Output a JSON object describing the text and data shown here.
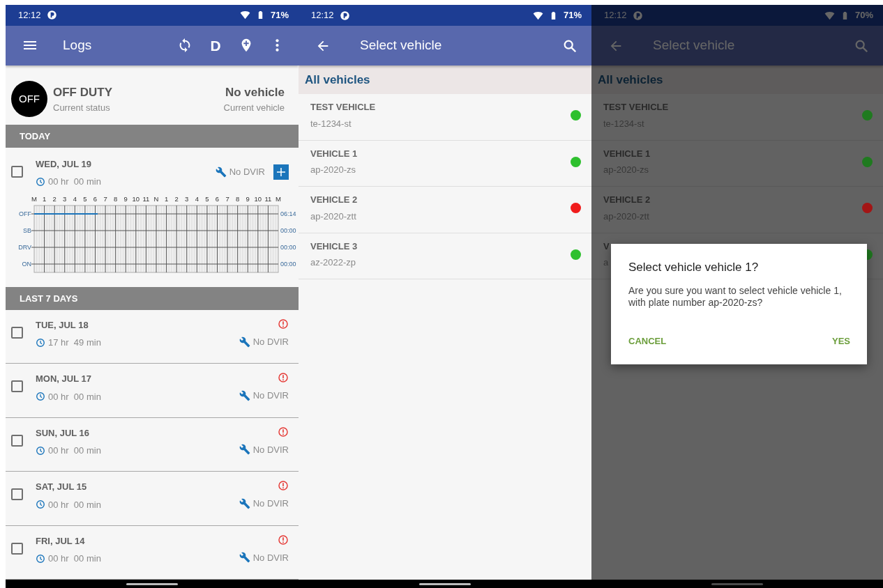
{
  "logs_screen": {
    "status_bar": {
      "time": "12:12",
      "battery": "71%"
    },
    "app_bar": {
      "title": "Logs",
      "driver_letter": "D"
    },
    "duty": {
      "badge": "OFF",
      "title": "OFF DUTY",
      "subtitle": "Current status"
    },
    "vehicle": {
      "title": "No vehicle",
      "subtitle": "Current vehicle"
    },
    "sections": [
      {
        "header": "TODAY",
        "days": [
          {
            "kind": "today",
            "date": "WED, JUL 19",
            "duration": "00 hr  00 min",
            "dvir": "No DVIR",
            "checked": false,
            "violation": false,
            "log_graph": {
              "hour_labels": [
                "M",
                "1",
                "2",
                "3",
                "4",
                "5",
                "6",
                "7",
                "8",
                "9",
                "10",
                "11",
                "N",
                "1",
                "2",
                "3",
                "4",
                "5",
                "6",
                "7",
                "8",
                "9",
                "10",
                "11",
                "M"
              ],
              "rows": [
                {
                  "label": "OFF",
                  "total": "06:14",
                  "level": 0.26
                },
                {
                  "label": "SB",
                  "total": "00:00"
                },
                {
                  "label": "DRV",
                  "total": "00:00"
                },
                {
                  "label": "ON",
                  "total": "00:00"
                }
              ]
            }
          }
        ]
      },
      {
        "header": "LAST 7 DAYS",
        "days": [
          {
            "kind": "past",
            "date": "TUE, JUL 18",
            "duration": "17 hr  49 min",
            "dvir": "No DVIR",
            "checked": false,
            "violation": true
          },
          {
            "kind": "past",
            "date": "MON, JUL 17",
            "duration": "00 hr  00 min",
            "dvir": "No DVIR",
            "checked": false,
            "violation": true
          },
          {
            "kind": "past",
            "date": "SUN, JUL 16",
            "duration": "00 hr  00 min",
            "dvir": "No DVIR",
            "checked": false,
            "violation": true
          },
          {
            "kind": "past",
            "date": "SAT, JUL 15",
            "duration": "00 hr  00 min",
            "dvir": "No DVIR",
            "checked": false,
            "violation": true
          },
          {
            "kind": "past",
            "date": "FRI, JUL 14",
            "duration": "00 hr  00 min",
            "dvir": "No DVIR",
            "checked": false,
            "violation": true
          }
        ]
      }
    ]
  },
  "vehicle_screen": {
    "status_bar": {
      "time": "12:12",
      "battery": "71%"
    },
    "app_bar": {
      "title": "Select vehicle"
    },
    "list_header": "All vehicles",
    "vehicles": [
      {
        "name": "TEST VEHICLE",
        "plate": "te-1234-st",
        "color": "#2ec02e"
      },
      {
        "name": "VEHICLE 1",
        "plate": "ap-2020-zs",
        "color": "#2ec02e"
      },
      {
        "name": "VEHICLE 2",
        "plate": "ap-2020-ztt",
        "color": "#f01c1c"
      },
      {
        "name": "VEHICLE 3",
        "plate": "az-2022-zp",
        "color": "#2ec02e"
      }
    ]
  },
  "confirm_screen": {
    "status_bar": {
      "time": "12:12",
      "battery": "70%"
    },
    "app_bar": {
      "title": "Select vehicle"
    },
    "list_header": "All vehicles",
    "vehicles": [
      {
        "name": "TEST VEHICLE",
        "plate": "te-1234-st",
        "color": "#1f7a1f"
      },
      {
        "name": "VEHICLE 1",
        "plate": "ap-2020-zs",
        "color": "#1f7a1f"
      },
      {
        "name": "VEHICLE 2",
        "plate": "ap-2020-ztt",
        "color": "#a31515"
      },
      {
        "name": "V",
        "plate": "a",
        "color": "#1f7a1f"
      }
    ],
    "dialog": {
      "title": "Select vehicle vehicle 1?",
      "message": "Are you sure you want to select vehicle vehicle 1, with plate number ap-2020-zs?",
      "buttons": [
        "CANCEL",
        "YES"
      ]
    }
  }
}
